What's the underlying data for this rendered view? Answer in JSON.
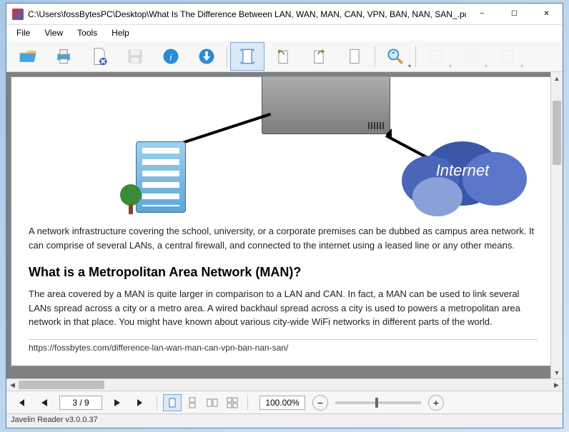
{
  "window": {
    "title": "C:\\Users\\fossBytesPC\\Desktop\\What Is The Difference Between LAN, WAN, MAN, CAN, VPN, BAN, NAN, SAN_.pdf"
  },
  "menubar": {
    "file": "File",
    "view": "View",
    "tools": "Tools",
    "help": "Help"
  },
  "document": {
    "cloud_label": "Internet",
    "para1": "A network infrastructure covering the school, university, or a corporate premises can be dubbed as campus area network. It can comprise of several LANs, a central firewall, and connected to the internet using a leased line or any other means.",
    "heading": "What is a Metropolitan Area Network (MAN)?",
    "para2": "The area covered by a MAN is quite larger in comparison to a LAN and CAN. In fact, a MAN can be used to link several LANs spread across a city or a metro area. A wired backhaul spread across a city is used to powers a metropolitan area network in that place. You might have known about various city-wide WiFi networks in different parts of the world.",
    "url": "https://fossbytes.com/difference-lan-wan-man-can-vpn-ban-nan-san/"
  },
  "navigation": {
    "page_indicator": "3 / 9",
    "zoom_level": "100.00%"
  },
  "status": {
    "text": "Javelin Reader v3.0.0.37"
  }
}
